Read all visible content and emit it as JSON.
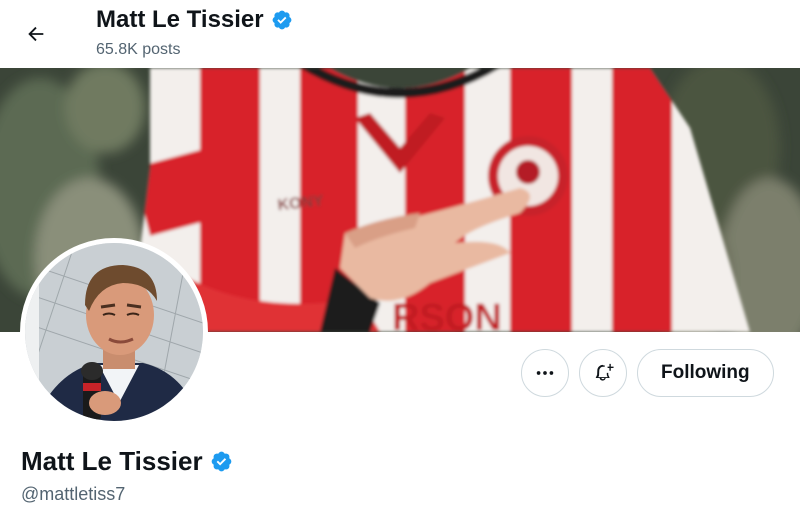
{
  "header": {
    "back_icon": "arrow-left-icon",
    "name": "Matt Le Tissier",
    "verified_icon": "verified-badge-icon",
    "posts": "65.8K posts"
  },
  "banner": {
    "description_colors": {
      "stripe_red": "#d8232a",
      "stripe_white": "#f4f1ee"
    },
    "shirt_text": "RSON",
    "sponsor_text": "KONY"
  },
  "profile": {
    "name": "Matt Le Tissier",
    "handle": "@mattletiss7",
    "verified_icon": "verified-badge-icon"
  },
  "actions": {
    "more_icon": "more-horizontal-icon",
    "notify_icon": "bell-plus-icon",
    "following_label": "Following"
  },
  "colors": {
    "verified_blue": "#1d9bf0",
    "text_primary": "#0f1419",
    "text_secondary": "#536471",
    "border": "#cfd9de"
  }
}
